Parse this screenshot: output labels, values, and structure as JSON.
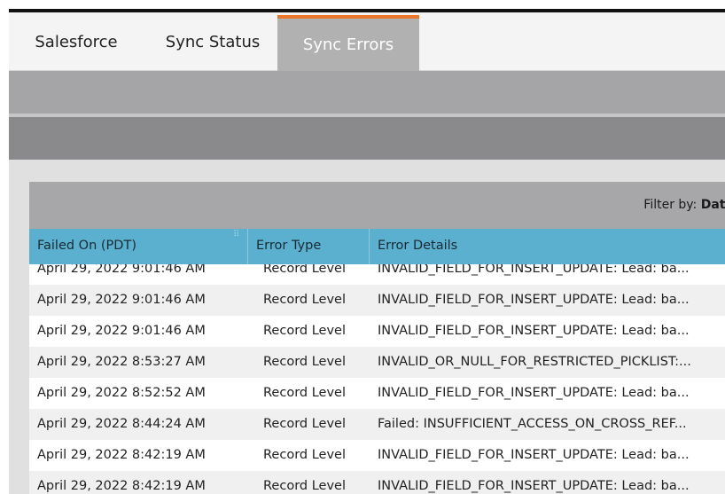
{
  "tabs": {
    "salesforce": "Salesforce",
    "sync_status": "Sync Status",
    "sync_errors": "Sync Errors"
  },
  "filter": {
    "label": "Filter by:",
    "value": "Date"
  },
  "table": {
    "columns": [
      "Failed On (PDT)",
      "Error Type",
      "Error Details"
    ],
    "rows": [
      {
        "failed_on": "April 29, 2022 9:01:46 AM",
        "error_type": "Record Level",
        "error_details": "INVALID_FIELD_FOR_INSERT_UPDATE: Lead: ba..."
      },
      {
        "failed_on": "April 29, 2022 9:01:46 AM",
        "error_type": "Record Level",
        "error_details": "INVALID_FIELD_FOR_INSERT_UPDATE: Lead: ba..."
      },
      {
        "failed_on": "April 29, 2022 9:01:46 AM",
        "error_type": "Record Level",
        "error_details": "INVALID_FIELD_FOR_INSERT_UPDATE: Lead: ba..."
      },
      {
        "failed_on": "April 29, 2022 8:53:27 AM",
        "error_type": "Record Level",
        "error_details": "INVALID_OR_NULL_FOR_RESTRICTED_PICKLIST:..."
      },
      {
        "failed_on": "April 29, 2022 8:52:52 AM",
        "error_type": "Record Level",
        "error_details": "INVALID_FIELD_FOR_INSERT_UPDATE: Lead: ba..."
      },
      {
        "failed_on": "April 29, 2022 8:44:24 AM",
        "error_type": "Record Level",
        "error_details": "Failed: INSUFFICIENT_ACCESS_ON_CROSS_REF..."
      },
      {
        "failed_on": "April 29, 2022 8:42:19 AM",
        "error_type": "Record Level",
        "error_details": "INVALID_FIELD_FOR_INSERT_UPDATE: Lead: ba..."
      },
      {
        "failed_on": "April 29, 2022 8:42:19 AM",
        "error_type": "Record Level",
        "error_details": "INVALID_FIELD_FOR_INSERT_UPDATE: Lead: ba..."
      }
    ]
  },
  "colors": {
    "active_tab_accent": "#e8762c",
    "header_blue": "#5bb0d0"
  }
}
